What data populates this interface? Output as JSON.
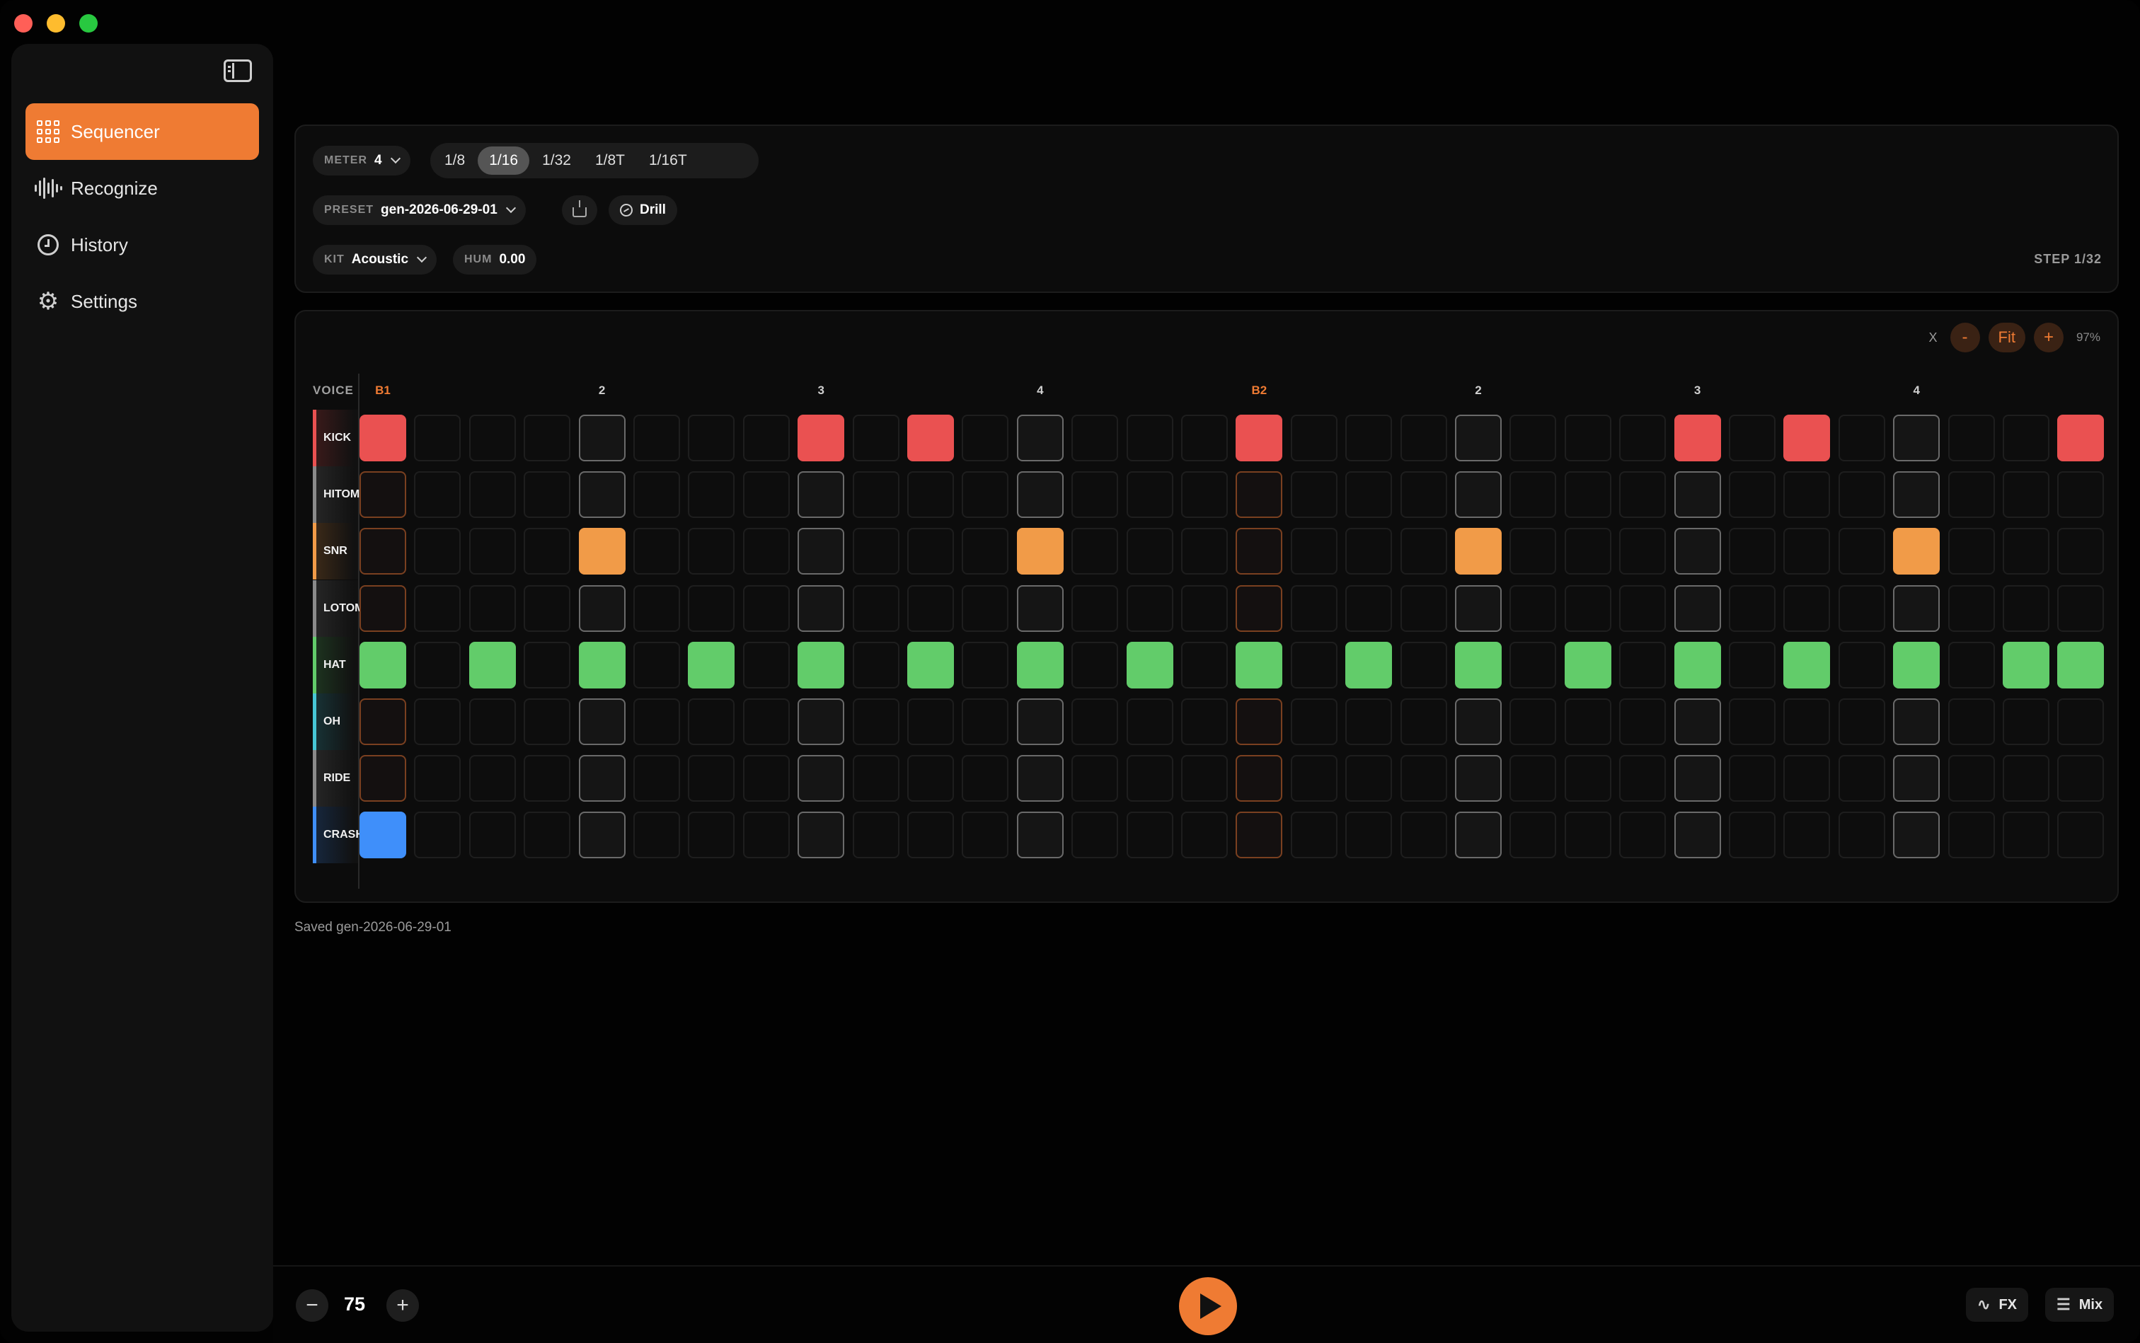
{
  "sidebar": {
    "items": [
      {
        "label": "Sequencer",
        "icon": "grid-icon",
        "active": true
      },
      {
        "label": "Recognize",
        "icon": "waveform-icon",
        "active": false
      },
      {
        "label": "History",
        "icon": "clock-icon",
        "active": false
      },
      {
        "label": "Settings",
        "icon": "gear-icon",
        "active": false
      }
    ]
  },
  "controls": {
    "meter_label": "METER",
    "meter_value": "4",
    "subdivisions": [
      "1/8",
      "1/16",
      "1/32",
      "1/8T",
      "1/16T"
    ],
    "subdivision_selected": "1/16",
    "preset_label": "PRESET",
    "preset_value": "gen-2026-06-29-01",
    "style_value": "Drill",
    "kit_label": "KIT",
    "kit_value": "Acoustic",
    "hum_label": "HUM",
    "hum_value": "0.00",
    "step_label": "STEP 1/32"
  },
  "zoom": {
    "x_label": "X",
    "minus_label": "-",
    "fit_label": "Fit",
    "plus_label": "+",
    "percent": "97%"
  },
  "sequencer": {
    "voice_header": "VOICE",
    "step_count": 32,
    "beat_labels": [
      "B1",
      "2",
      "3",
      "4",
      "B2",
      "2",
      "3",
      "4"
    ],
    "voices": [
      {
        "name": "KICK",
        "color": "#ea5151",
        "cls": "kick",
        "steps": [
          0,
          8,
          10,
          16,
          24,
          26,
          31
        ]
      },
      {
        "name": "HITOM",
        "color": "#8a8a8a",
        "cls": "",
        "steps": []
      },
      {
        "name": "SNR",
        "color": "#f19b48",
        "cls": "snr",
        "steps": [
          4,
          12,
          20,
          28
        ]
      },
      {
        "name": "LOTOM",
        "color": "#8a8a8a",
        "cls": "",
        "steps": []
      },
      {
        "name": "HAT",
        "color": "#62cc6a",
        "cls": "hat",
        "steps": [
          0,
          2,
          4,
          6,
          8,
          10,
          12,
          14,
          16,
          18,
          20,
          22,
          24,
          26,
          28,
          30,
          31
        ]
      },
      {
        "name": "OH",
        "color": "#47c7d6",
        "cls": "",
        "steps": []
      },
      {
        "name": "RIDE",
        "color": "#8a8a8a",
        "cls": "",
        "steps": []
      },
      {
        "name": "CRASH",
        "color": "#3f8ffa",
        "cls": "crash",
        "steps": [
          0
        ]
      }
    ]
  },
  "status": {
    "saved_text": "Saved gen-2026-06-29-01"
  },
  "transport": {
    "minus_label": "−",
    "tempo": "75",
    "plus_label": "+",
    "fx_label": "FX",
    "mix_label": "Mix"
  },
  "colors": {
    "accent": "#ef7b33",
    "kick": "#ea5151",
    "snare": "#f19b48",
    "hat": "#62cc6a",
    "crash": "#3f8ffa"
  }
}
